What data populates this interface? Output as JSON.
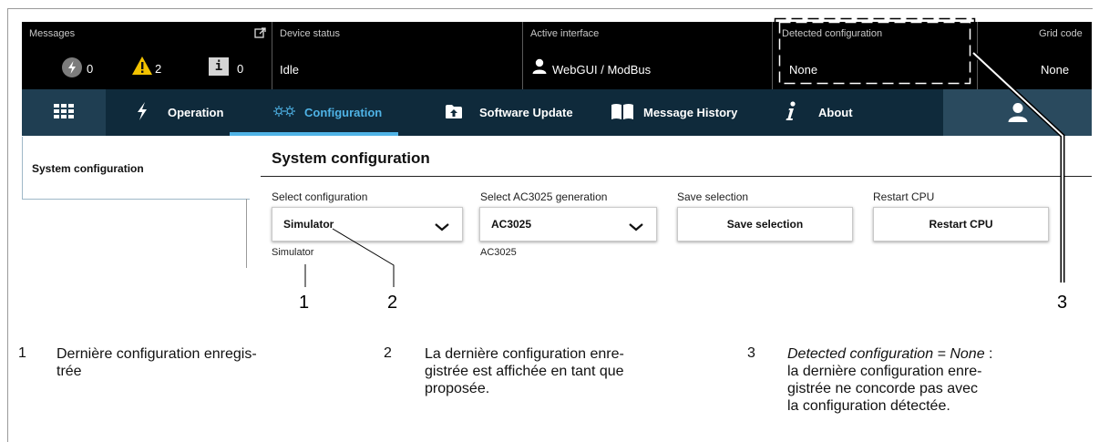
{
  "status_bar": {
    "messages": {
      "label": "Messages",
      "error_count": "0",
      "warning_count": "2",
      "info_count": "0",
      "icons": [
        "external-link-icon",
        "error-bolt-icon",
        "warning-triangle-icon",
        "info-icon"
      ]
    },
    "device_status": {
      "label": "Device status",
      "value": "Idle"
    },
    "active_interface": {
      "label": "Active interface",
      "value": "WebGUI / ModBus",
      "icon": "user-icon"
    },
    "detected_configuration": {
      "label": "Detected configuration",
      "value": "None"
    },
    "grid_code": {
      "label": "Grid code",
      "value": "None"
    }
  },
  "nav": {
    "items": [
      {
        "id": "grid",
        "label": "",
        "icon": "grid-menu-icon"
      },
      {
        "id": "operation",
        "label": "Operation",
        "icon": "lightning-icon"
      },
      {
        "id": "configuration",
        "label": "Configuration",
        "icon": "gears-icon",
        "active": true
      },
      {
        "id": "software_update",
        "label": "Software Update",
        "icon": "upload-icon"
      },
      {
        "id": "message_history",
        "label": "Message History",
        "icon": "book-icon"
      },
      {
        "id": "about",
        "label": "About",
        "icon": "info-italic-icon"
      },
      {
        "id": "user",
        "label": "",
        "icon": "user-icon"
      }
    ]
  },
  "sidebar": {
    "items": [
      {
        "label": "System configuration"
      }
    ]
  },
  "main": {
    "title": "System configuration",
    "select_configuration": {
      "label": "Select configuration",
      "value": "Simulator",
      "saved": "Simulator"
    },
    "select_generation": {
      "label": "Select AC3025 generation",
      "value": "AC3025",
      "saved": "AC3025"
    },
    "save_selection": {
      "label": "Save selection",
      "button": "Save selection"
    },
    "restart_cpu": {
      "label": "Restart CPU",
      "button": "Restart CPU"
    }
  },
  "callouts": {
    "n1": "1",
    "n2": "2",
    "n3": "3"
  },
  "legend": [
    {
      "number": "1",
      "lines": [
        "Dernière configuration enregis-",
        "trée"
      ]
    },
    {
      "number": "2",
      "lines": [
        "La dernière configuration enre-",
        "gistrée est affichée en tant que",
        "proposée."
      ]
    },
    {
      "number": "3",
      "emphasis": "Detected configuration = None",
      "after_emphasis": " :",
      "lines": [
        "la dernière configuration enre-",
        "gistrée ne concorde pas avec",
        "la configuration détectée."
      ]
    }
  ],
  "colors": {
    "status_bg": "#000000",
    "nav_bg": "#0f2a3b",
    "accent": "#4fb3e6",
    "warning": "#f2c200"
  }
}
